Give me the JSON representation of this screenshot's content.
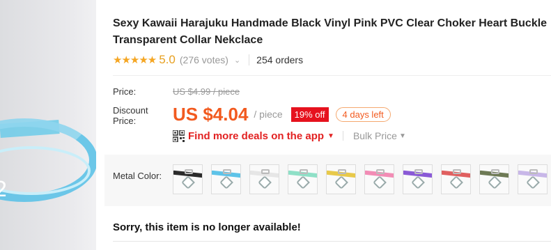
{
  "product": {
    "title": "Sexy Kawaii Harajuku Handmade Black Vinyl Pink PVC Clear Choker Heart Buckle Transparent Collar Nekclace",
    "rating": {
      "stars": "★★★★★",
      "score": "5.0",
      "votes": "(276 votes)",
      "orders": "254 orders"
    }
  },
  "pricing": {
    "price_label": "Price:",
    "original_price": "US $4.99 / piece",
    "discount_label_line1": "Discount",
    "discount_label_line2": "Price:",
    "discount_price": "US $4.04",
    "unit": "/ piece",
    "discount_badge": "19% off",
    "time_left": "4 days left"
  },
  "deals": {
    "app_deal_label": "Find more deals on the app",
    "bulk_price_label": "Bulk Price"
  },
  "colors": {
    "label": "Metal Color:",
    "swatches": [
      {
        "name": "black",
        "strap": "#2b2b2b"
      },
      {
        "name": "blue",
        "strap": "#5ec3e8"
      },
      {
        "name": "clear",
        "strap": "#e6e6e6"
      },
      {
        "name": "mint",
        "strap": "#8fe0c7"
      },
      {
        "name": "yellow",
        "strap": "#e8c94a"
      },
      {
        "name": "pink",
        "strap": "#f28cb5"
      },
      {
        "name": "purple",
        "strap": "#8a5ad6"
      },
      {
        "name": "red",
        "strap": "#e06060"
      },
      {
        "name": "olive",
        "strap": "#6e7a55"
      },
      {
        "name": "lavender",
        "strap": "#c8b7e8"
      }
    ]
  },
  "availability": {
    "message": "Sorry, this item is no longer available!"
  },
  "theme": {
    "accent": "#f25a1f",
    "badge": "#e6121e",
    "star": "#f5a623",
    "deal": "#e22222"
  }
}
